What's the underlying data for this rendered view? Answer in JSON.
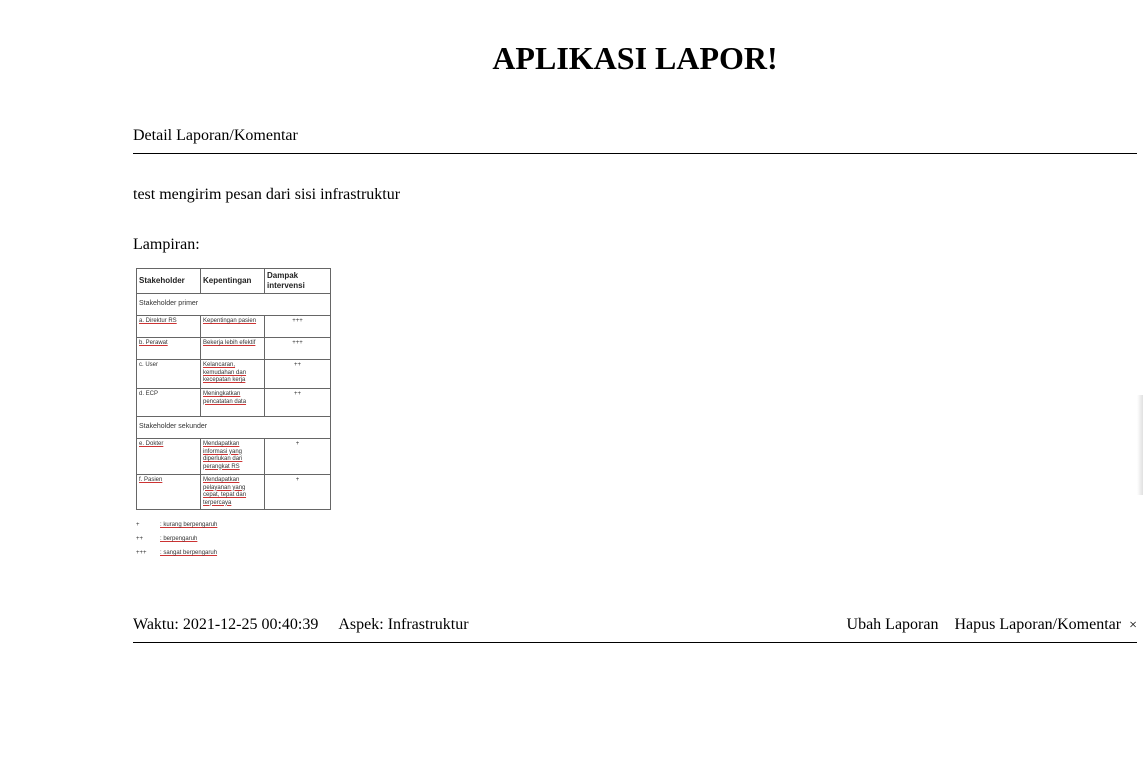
{
  "app": {
    "title": "APLIKASI LAPOR!"
  },
  "section": {
    "header": "Detail Laporan/Komentar"
  },
  "report": {
    "text": "test mengirim pesan dari sisi infrastruktur",
    "attachment_label": "Lampiran:"
  },
  "attachment": {
    "headers": [
      "Stakeholder",
      "Kepentingan",
      "Dampak intervensi"
    ],
    "group1": "Stakeholder primer",
    "group2": "Stakeholder sekunder",
    "rows1": [
      {
        "name": "a. Direktur RS",
        "interest": "Kepentingan pasien",
        "impact": "+++"
      },
      {
        "name": "b. Perawat",
        "interest": "Bekerja lebih efektif",
        "impact": "+++"
      },
      {
        "name": "c. User",
        "interest": "Kelancaran, kemudahan dan kecepatan kerja",
        "impact": "++"
      },
      {
        "name": "d. ECP",
        "interest": "Meningkatkan pencatatan data",
        "impact": "++"
      }
    ],
    "rows2": [
      {
        "name": "e. Dokter",
        "interest": "Mendapatkan informasi yang diperlukan dari perangkat RS",
        "impact": "+"
      },
      {
        "name": "f. Pasien",
        "interest": "Mendapatkan pelayanan yang cepat, tepat dan terpercaya",
        "impact": "+"
      }
    ],
    "legend": [
      {
        "sym": "+",
        "text": ": kurang berpengaruh"
      },
      {
        "sym": "++",
        "text": ": berpengaruh"
      },
      {
        "sym": "+++",
        "text": ": sangat berpengaruh"
      }
    ]
  },
  "footer": {
    "time": "Waktu: 2021-12-25 00:40:39",
    "aspect": "Aspek: Infrastruktur",
    "edit_label": "Ubah Laporan",
    "delete_label": "Hapus Laporan/Komentar",
    "close_glyph": "×"
  }
}
